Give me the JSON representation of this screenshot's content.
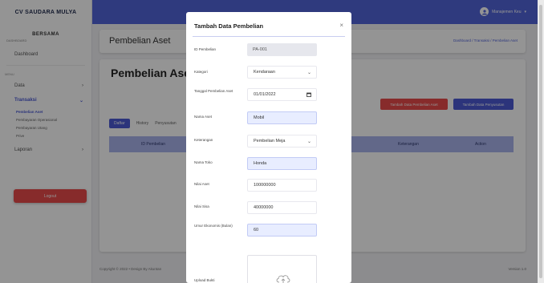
{
  "sidebar": {
    "brand": "CV SAUDARA MULYA",
    "company": "BERSAMA",
    "company_sub": "DASHBOARD",
    "items": [
      {
        "label": "Dashboard"
      },
      {
        "label": "Data"
      },
      {
        "label": "Transaksi"
      },
      {
        "label": "Pembelian Aset"
      },
      {
        "label": "Pembayaran Operasional"
      },
      {
        "label": "Pembayaran Utang"
      },
      {
        "label": "Prive"
      },
      {
        "label": "Laporan"
      }
    ],
    "section_label": "MENU",
    "logout": "Logout"
  },
  "topbar": {
    "user_name": "Manajemen Keu",
    "accent": "#5264d9"
  },
  "header": {
    "title": "Pembelian Aset",
    "breadcrumb": "Dashboard / Transaksi / Pembelian Aset"
  },
  "main": {
    "title": "Pembelian Aset",
    "btn_red": "Tambah Data Pembelian Aset",
    "btn_blue": "Tambah Data Penyusutan",
    "tabs": [
      "Daftar",
      "History",
      "Penyusutan"
    ],
    "columns": [
      "ID Pembelian",
      "Keterangan",
      "Action"
    ]
  },
  "footer": {
    "left": "Copyright © 2022 • Design By Akuntan",
    "right": "Version 1.0"
  },
  "modal": {
    "title": "Tambah Data Pembelian",
    "close": "×",
    "fields": [
      {
        "label": "ID Pembelian",
        "value": "PA-001"
      },
      {
        "label": "Kategori",
        "value": "Kendaraan"
      },
      {
        "label": "Tanggal Pembelian Aset",
        "value": "01/01/2022"
      },
      {
        "label": "Nama Aset",
        "value": "Mobil"
      },
      {
        "label": "Keterangan",
        "value": "Pembelian Meja"
      },
      {
        "label": "Nama Toko",
        "value": "Honda"
      },
      {
        "label": "Nilai Aset",
        "value": "100000000"
      },
      {
        "label": "Nilai Sisa",
        "value": "40000000"
      },
      {
        "label": "Umur Ekonomis (Bulan)",
        "value": "60"
      },
      {
        "label": "Upload Bukti",
        "value": ""
      }
    ]
  },
  "icons": {
    "close": "close-icon",
    "chevron": "chevron-down-icon",
    "calendar": "calendar-icon",
    "upload": "cloud-upload-icon",
    "user": "user-icon"
  }
}
